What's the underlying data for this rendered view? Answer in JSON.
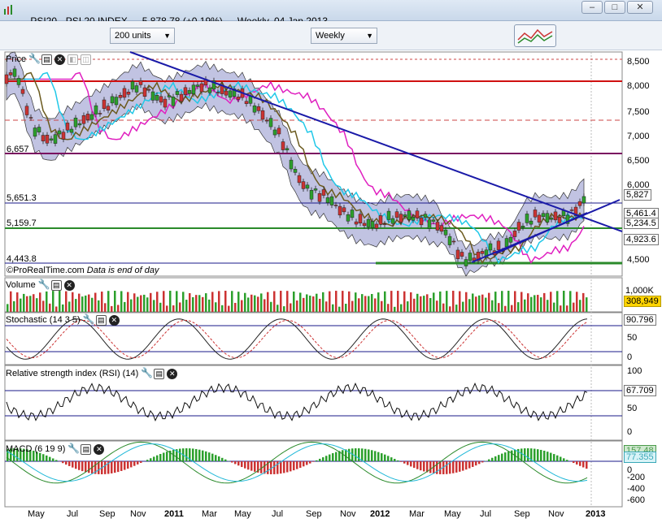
{
  "window": {
    "symbol": "PSI20 - PSI 20 INDEX",
    "last": "5,878.78 (+0.19%)",
    "period": "Weekly",
    "date": "04 Jan 2013"
  },
  "toolbar": {
    "units_value": "200 units",
    "period_value": "Weekly"
  },
  "panels": {
    "price": {
      "label": "Price"
    },
    "volume": {
      "label": "Volume"
    },
    "stochastic": {
      "label": "Stochastic (14 3 5)"
    },
    "rsi": {
      "label": "Relative strength index (RSI) (14)"
    },
    "macd": {
      "label": "MACD (6 19 9)"
    }
  },
  "footer": {
    "source": "©ProRealTime.com",
    "note": "Data is end of day"
  },
  "price_axis": [
    "8,500",
    "8,000",
    "7,500",
    "7,000",
    "6,500",
    "6,000",
    "4,500"
  ],
  "price_tags": {
    "last": "5,827",
    "t1": "5,461.4",
    "t2": "5,234.5",
    "t3": "4,923.6"
  },
  "hlines": {
    "l1": "6,657",
    "l2": "5,651.3",
    "l3": "5,159.7",
    "l4": "4,443.8"
  },
  "volume_axis": {
    "top": "1,000K",
    "tag": "308,949"
  },
  "stoch_axis": {
    "tag": "90.796",
    "mid": "50",
    "low": "0"
  },
  "rsi_axis": {
    "top": "100",
    "tag": "67.709",
    "mid": "50",
    "low": "0"
  },
  "macd_axis": {
    "tag_top": "157.48",
    "tag": "77.355",
    "l0": "0",
    "l1": "-200",
    "l2": "-400",
    "l3": "-600"
  },
  "months": [
    {
      "label": "May",
      "year": false
    },
    {
      "label": "Jul",
      "year": false
    },
    {
      "label": "Sep",
      "year": false
    },
    {
      "label": "Nov",
      "year": false
    },
    {
      "label": "2011",
      "year": true
    },
    {
      "label": "Mar",
      "year": false
    },
    {
      "label": "May",
      "year": false
    },
    {
      "label": "Jul",
      "year": false
    },
    {
      "label": "Sep",
      "year": false
    },
    {
      "label": "Nov",
      "year": false
    },
    {
      "label": "2012",
      "year": true
    },
    {
      "label": "Mar",
      "year": false
    },
    {
      "label": "May",
      "year": false
    },
    {
      "label": "Jul",
      "year": false
    },
    {
      "label": "Sep",
      "year": false
    },
    {
      "label": "Nov",
      "year": false
    },
    {
      "label": "2013",
      "year": true
    }
  ],
  "colors": {
    "up": "#2ca02c",
    "down": "#cc3333",
    "band": "#a7a9d6",
    "trend": "#1a1aa8",
    "ma_pink": "#e020c0",
    "ma_cyan": "#20c8e8",
    "ma_olive": "#6b5a1e"
  }
}
